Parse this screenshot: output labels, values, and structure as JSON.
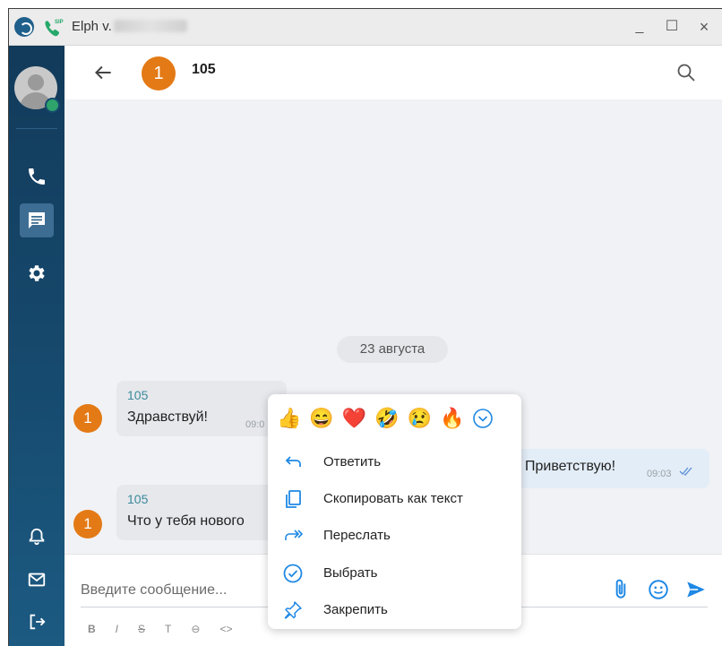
{
  "window": {
    "title": "Elph v.",
    "minimize": "_",
    "maximize": "☐",
    "close": "×"
  },
  "sidebar": {
    "items": [
      {
        "name": "calls",
        "icon": "phone-icon"
      },
      {
        "name": "messages",
        "icon": "chat-icon",
        "active": true
      },
      {
        "name": "settings",
        "icon": "gear-icon"
      },
      {
        "name": "notifications",
        "icon": "bell-icon"
      },
      {
        "name": "mail",
        "icon": "mail-icon"
      },
      {
        "name": "logout",
        "icon": "logout-icon"
      }
    ]
  },
  "chat": {
    "contact_avatar": "1",
    "contact_name": "105",
    "date_divider": "23 августа",
    "messages": [
      {
        "avatar": "1",
        "sender": "105",
        "text": "Здравствуй!",
        "time": "09:0"
      },
      {
        "text": "Приветствую!",
        "time": "09:03",
        "outgoing": true,
        "read": true
      },
      {
        "avatar": "1",
        "sender": "105",
        "text": "Что у тебя нового"
      }
    ]
  },
  "composer": {
    "placeholder": "Введите сообщение...",
    "format_buttons": [
      "B",
      "I",
      "S",
      "T",
      "⊖",
      "<>"
    ]
  },
  "context_menu": {
    "reactions": [
      "👍",
      "😄",
      "❤️",
      "🤣",
      "😢",
      "🔥"
    ],
    "items": [
      {
        "label": "Ответить",
        "icon": "reply-icon"
      },
      {
        "label": "Скопировать как текст",
        "icon": "copy-icon"
      },
      {
        "label": "Переслать",
        "icon": "forward-icon"
      },
      {
        "label": "Выбрать",
        "icon": "select-check-icon"
      },
      {
        "label": "Закрепить",
        "icon": "pin-icon"
      }
    ]
  },
  "colors": {
    "accent": "#1e88e5",
    "avatar": "#e37a16",
    "sidebar": "#164a6e",
    "sender_name": "#3d8a9c"
  }
}
